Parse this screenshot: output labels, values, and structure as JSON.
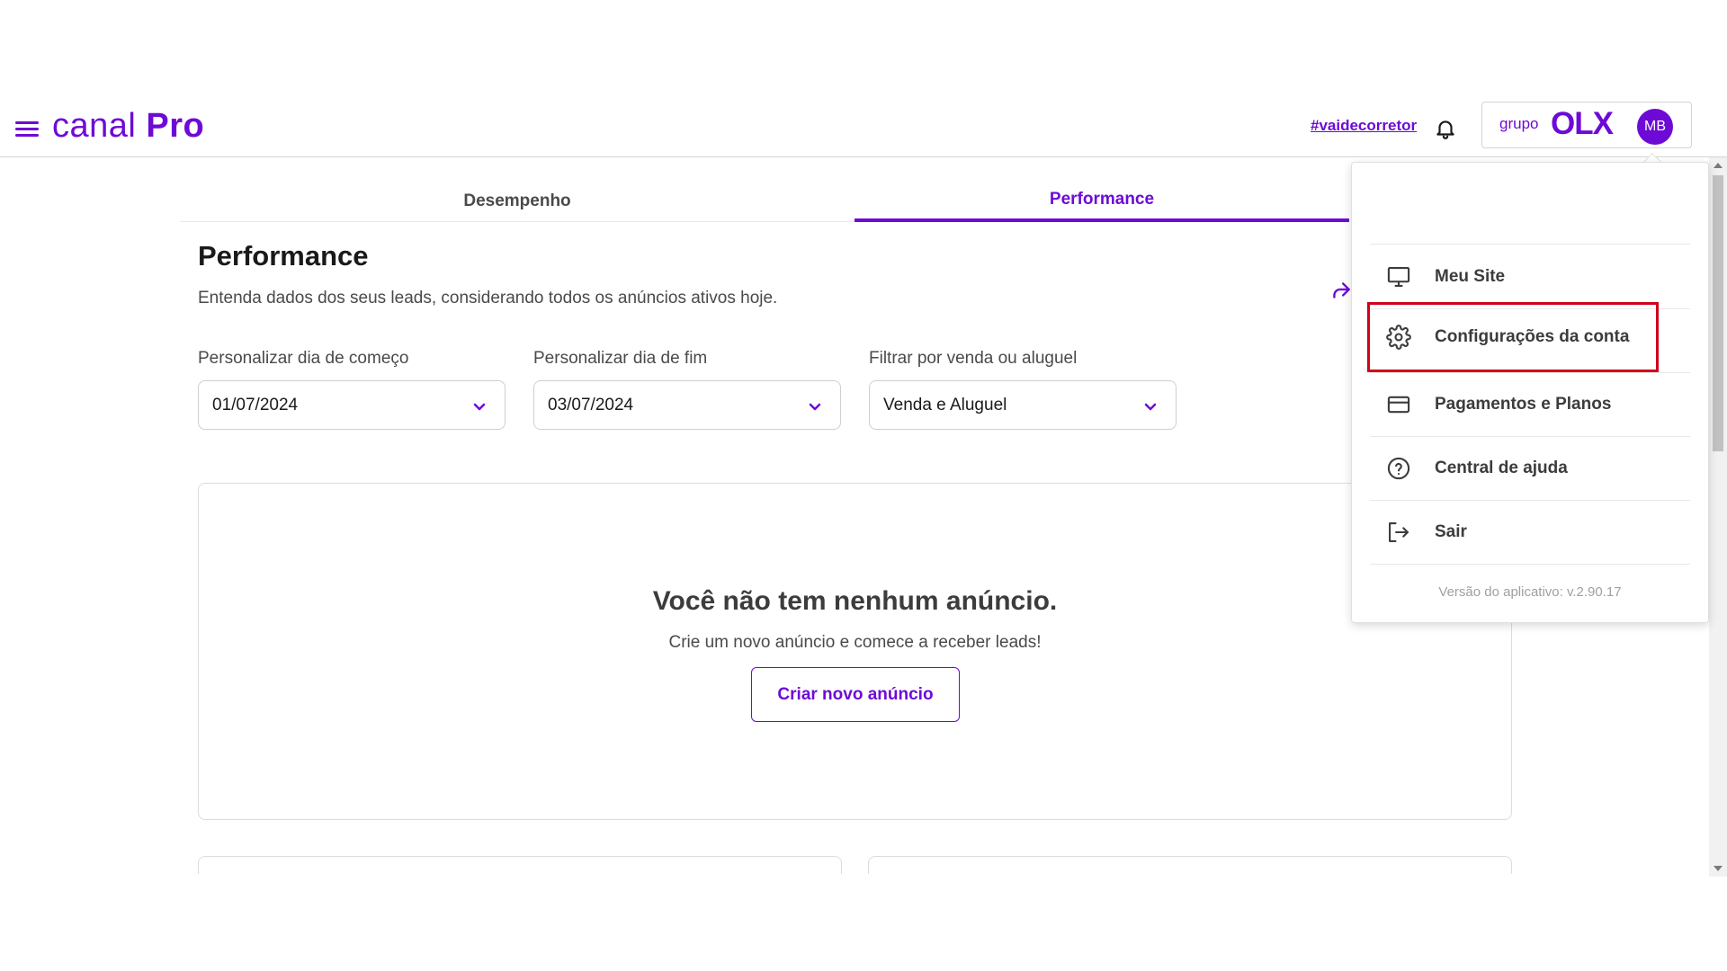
{
  "header": {
    "brand_light": "canal",
    "brand_bold": "Pro",
    "hashtag": "#vaidecorretor",
    "grupo": "grupo",
    "olx": "OLX",
    "avatar_initials": "MB"
  },
  "tabs": [
    {
      "label": "Desempenho",
      "active": false
    },
    {
      "label": "Performance",
      "active": true
    }
  ],
  "page": {
    "title": "Performance",
    "subtitle": "Entenda dados dos seus leads, considerando todos os anúncios ativos hoje."
  },
  "filters": [
    {
      "label": "Personalizar dia de começo",
      "value": "01/07/2024"
    },
    {
      "label": "Personalizar dia de fim",
      "value": "03/07/2024"
    },
    {
      "label": "Filtrar por venda ou aluguel",
      "value": "Venda e Aluguel"
    }
  ],
  "empty_state": {
    "title": "Você não tem nenhum anúncio.",
    "subtitle": "Crie um novo anúncio e comece a receber leads!",
    "button": "Criar novo anúncio"
  },
  "menu": {
    "items": [
      {
        "label": "Meu Site",
        "icon": "monitor-icon"
      },
      {
        "label": "Configurações da conta",
        "icon": "gear-icon",
        "highlighted": true
      },
      {
        "label": "Pagamentos e Planos",
        "icon": "credit-card-icon"
      },
      {
        "label": "Central de ajuda",
        "icon": "help-circle-icon"
      },
      {
        "label": "Sair",
        "icon": "logout-icon"
      }
    ],
    "version": "Versão do aplicativo: v.2.90.17"
  },
  "colors": {
    "brand": "#6e0ad6",
    "highlight": "#d0021b"
  }
}
